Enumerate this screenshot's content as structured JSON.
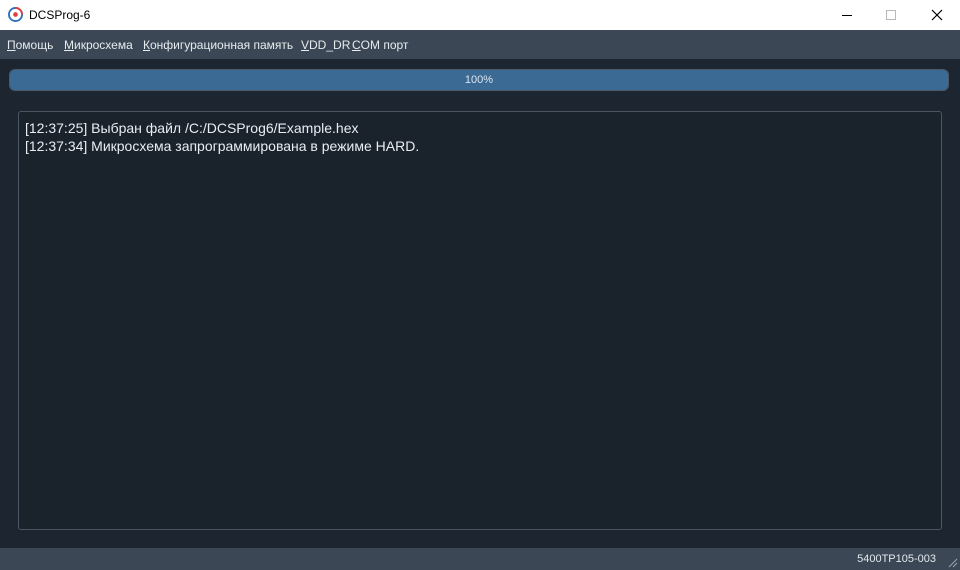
{
  "window": {
    "title": "DCSProg-6"
  },
  "menu": {
    "items": [
      {
        "accel": "П",
        "rest": "омощь"
      },
      {
        "accel": "М",
        "rest": "икросхема"
      },
      {
        "accel": "К",
        "rest": "онфигурационная память"
      },
      {
        "accel": "V",
        "rest": "DD_DR"
      },
      {
        "accel": "C",
        "rest": "OM порт"
      }
    ]
  },
  "progress": {
    "value": 100,
    "label": "100%"
  },
  "log": {
    "lines": [
      "[12:37:25] Выбран файл /C:/DCSProg6/Example.hex",
      "[12:37:34] Микросхема запрограммирована в режиме HARD."
    ]
  },
  "status": {
    "chip": "5400ТР105-003"
  },
  "colors": {
    "accent": "#3b6a94",
    "background": "#1c2530",
    "bars": "#3b4754"
  }
}
